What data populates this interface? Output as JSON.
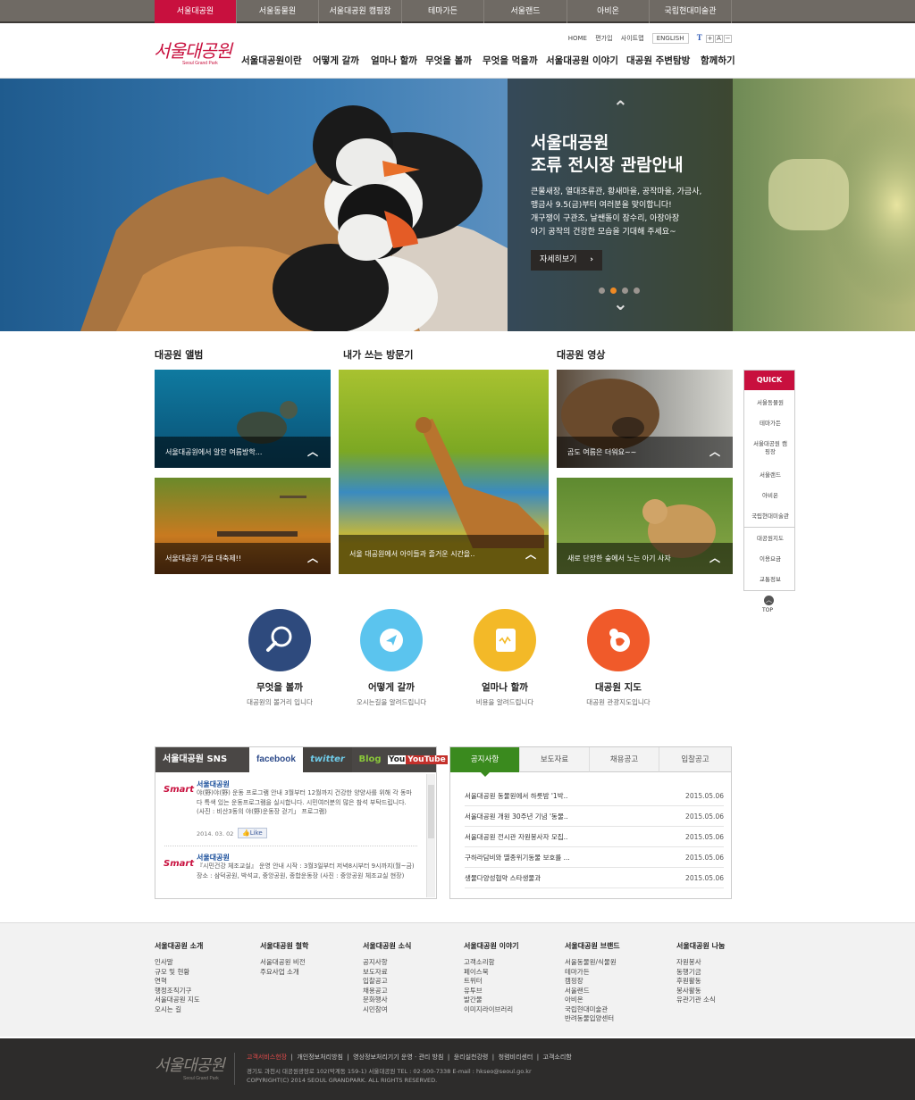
{
  "top_tabs": [
    "서울대공원",
    "서울동물원",
    "서울대공원 캠핑장",
    "테마가든",
    "서울랜드",
    "아비온",
    "국립현대미술관"
  ],
  "logo": {
    "text": "서울대공원",
    "sub": "Seoul Grand Park"
  },
  "util": {
    "home": "HOME",
    "join": "편가입",
    "sitemap": "사이트맵",
    "english": "ENGLISH",
    "font_t": "T",
    "font_plus": "+",
    "font_a": "A",
    "font_minus": "−"
  },
  "gnb": [
    "서울대공원이란",
    "어떻게 갈까",
    "얼마나 할까",
    "무엇을 볼까",
    "무엇을 먹을까",
    "서울대공원 이야기",
    "대공원 주변탐방",
    "함께하기"
  ],
  "hero": {
    "title_1": "서울대공원",
    "title_2": "조류 전시장 관람안내",
    "desc_1": "큰물새장, 열대조류관, 황새마을, 공작마을, 가금사,",
    "desc_2": "맹금사 9.5(금)부터 여러분을 맞이합니다!",
    "desc_3": "개구쟁이 구관조, 날쌘돌이 잠수리, 아장아장",
    "desc_4": "아기 공작의 건강한 모습을 기대해 주세요~",
    "button": "자세히보기",
    "prev_arrow": "⌃",
    "next_arrow": "⌄"
  },
  "sections": {
    "album": "대공원 앨범",
    "guestbook": "내가 쓰는 방문기",
    "video": "대공원 영상"
  },
  "captions": {
    "album_1": "서울대공원에서 알찬 여름방학...",
    "album_2": "서울대공원 가을 대축제!!",
    "guest_1": "서울 대공원에서 아이들과 즐거운 시간을..",
    "video_1": "곰도 여름은 더워요~~",
    "video_2": "새로 단장한 숲에서 노는 아기 사자"
  },
  "quick": {
    "title": "QUICK",
    "items": [
      "서울동물원",
      "테마가든",
      "서울대공원 캠핑장",
      "서울랜드",
      "아비온",
      "국립현대미술관",
      "대공원지도",
      "이용요금",
      "교통정보"
    ],
    "top": "TOP"
  },
  "circles": [
    {
      "title": "무엇을 볼까",
      "sub": "대공원의 볼거리 입니다",
      "color": "#2e4a7d"
    },
    {
      "title": "어떻게 갈까",
      "sub": "오시는길을 알려드립니다",
      "color": "#5bc4ee"
    },
    {
      "title": "얼마나 할까",
      "sub": "비용을 알려드립니다",
      "color": "#f3b928"
    },
    {
      "title": "대공원 지도",
      "sub": "대공원 관광지도입니다",
      "color": "#f05a2a"
    }
  ],
  "sns": {
    "title": "서울대공원 SNS",
    "tabs": [
      "facebook",
      "twitter",
      "Blog",
      "YouTube"
    ],
    "logo": "Smart",
    "posts": [
      {
        "name": "서울대공원",
        "text": "야(野)야(野) 운동 프로그램 안내 3월부터 12월까지 건강한 양양사를 위해 각 동마다 특색 있는 운동프로그램을 실시합니다. 시민여러분의 많은 참석 부탁드립니다. (사진 : 비산3동의 야(野)운동장 걷기」 프로그램)",
        "date": "2014. 03. 02",
        "like": "Like"
      },
      {
        "name": "서울대공원",
        "text": "『시민건강 체조교실』 운영 안내 시작 : 3월3일부터 저녁8시부터 9시까지(월~금) 장소 : 삼덕공원, 박석교, 중앙공원, 종합운동장 (사진 : 중앙공원 체조교실 현장)"
      }
    ]
  },
  "notice": {
    "tabs": [
      "공지사항",
      "보도자료",
      "채용공고",
      "입찰공고"
    ],
    "rows": [
      {
        "title": "서울대공원 동물원에서 하룻밤 '1박..",
        "date": "2015.05.06"
      },
      {
        "title": "서울대공원 개원 30주년 기념 '동물..",
        "date": "2015.05.06"
      },
      {
        "title": "서울대공원 전시관 자원봉사자 모집..",
        "date": "2015.05.06"
      },
      {
        "title": "구하라담비와 멸종위기동물 보호를 ...",
        "date": "2015.05.06"
      },
      {
        "title": "생물다양성협약 스타생물과",
        "date": "2015.05.06"
      }
    ]
  },
  "footer_nav": [
    {
      "head": "서울대공원 소개",
      "items": [
        "인사말",
        "규모 및 현황",
        "연혁",
        "행정조직기구",
        "서울대공원 지도",
        "오시는 길"
      ]
    },
    {
      "head": "서울대공원 철학",
      "items": [
        "서울대공원 비전",
        "주요사업 소개"
      ]
    },
    {
      "head": "서울대공원 소식",
      "items": [
        "공지사항",
        "보도자료",
        "입찰공고",
        "채용공고",
        "문화행사",
        "시민참여"
      ]
    },
    {
      "head": "서울대공원 이야기",
      "items": [
        "고객소리함",
        "페이스북",
        "트위터",
        "유투브",
        "발간물",
        "이미지라이브러리"
      ]
    },
    {
      "head": "서울대공원 브랜드",
      "items": [
        "서울동물원/식물원",
        "테마가든",
        "캠핑장",
        "서울랜드",
        "아비온",
        "국립현대미술관",
        "반려동물입양센터"
      ]
    },
    {
      "head": "서울대공원 나눔",
      "items": [
        "자원봉사",
        "동행기금",
        "후원활동",
        "봉사활동",
        "유관기관 소식"
      ]
    }
  ],
  "footer": {
    "links": [
      "고객서비스헌장",
      "개인정보처리방침",
      "영상정보처리기기 운영 · 관리 방침",
      "윤리실천강령",
      "청렴비리센터",
      "고객소리함"
    ],
    "address": "경기도 과천시 대공원광장로 102(막계동 159-1) 서울대공원 TEL : 02-500-7338 E-mail : hkseo@seoul.go.kr",
    "copyright": "COPYRIGHT(C) 2014 SEOUL GRANDPARK.  ALL RIGHTS RESERVED."
  }
}
